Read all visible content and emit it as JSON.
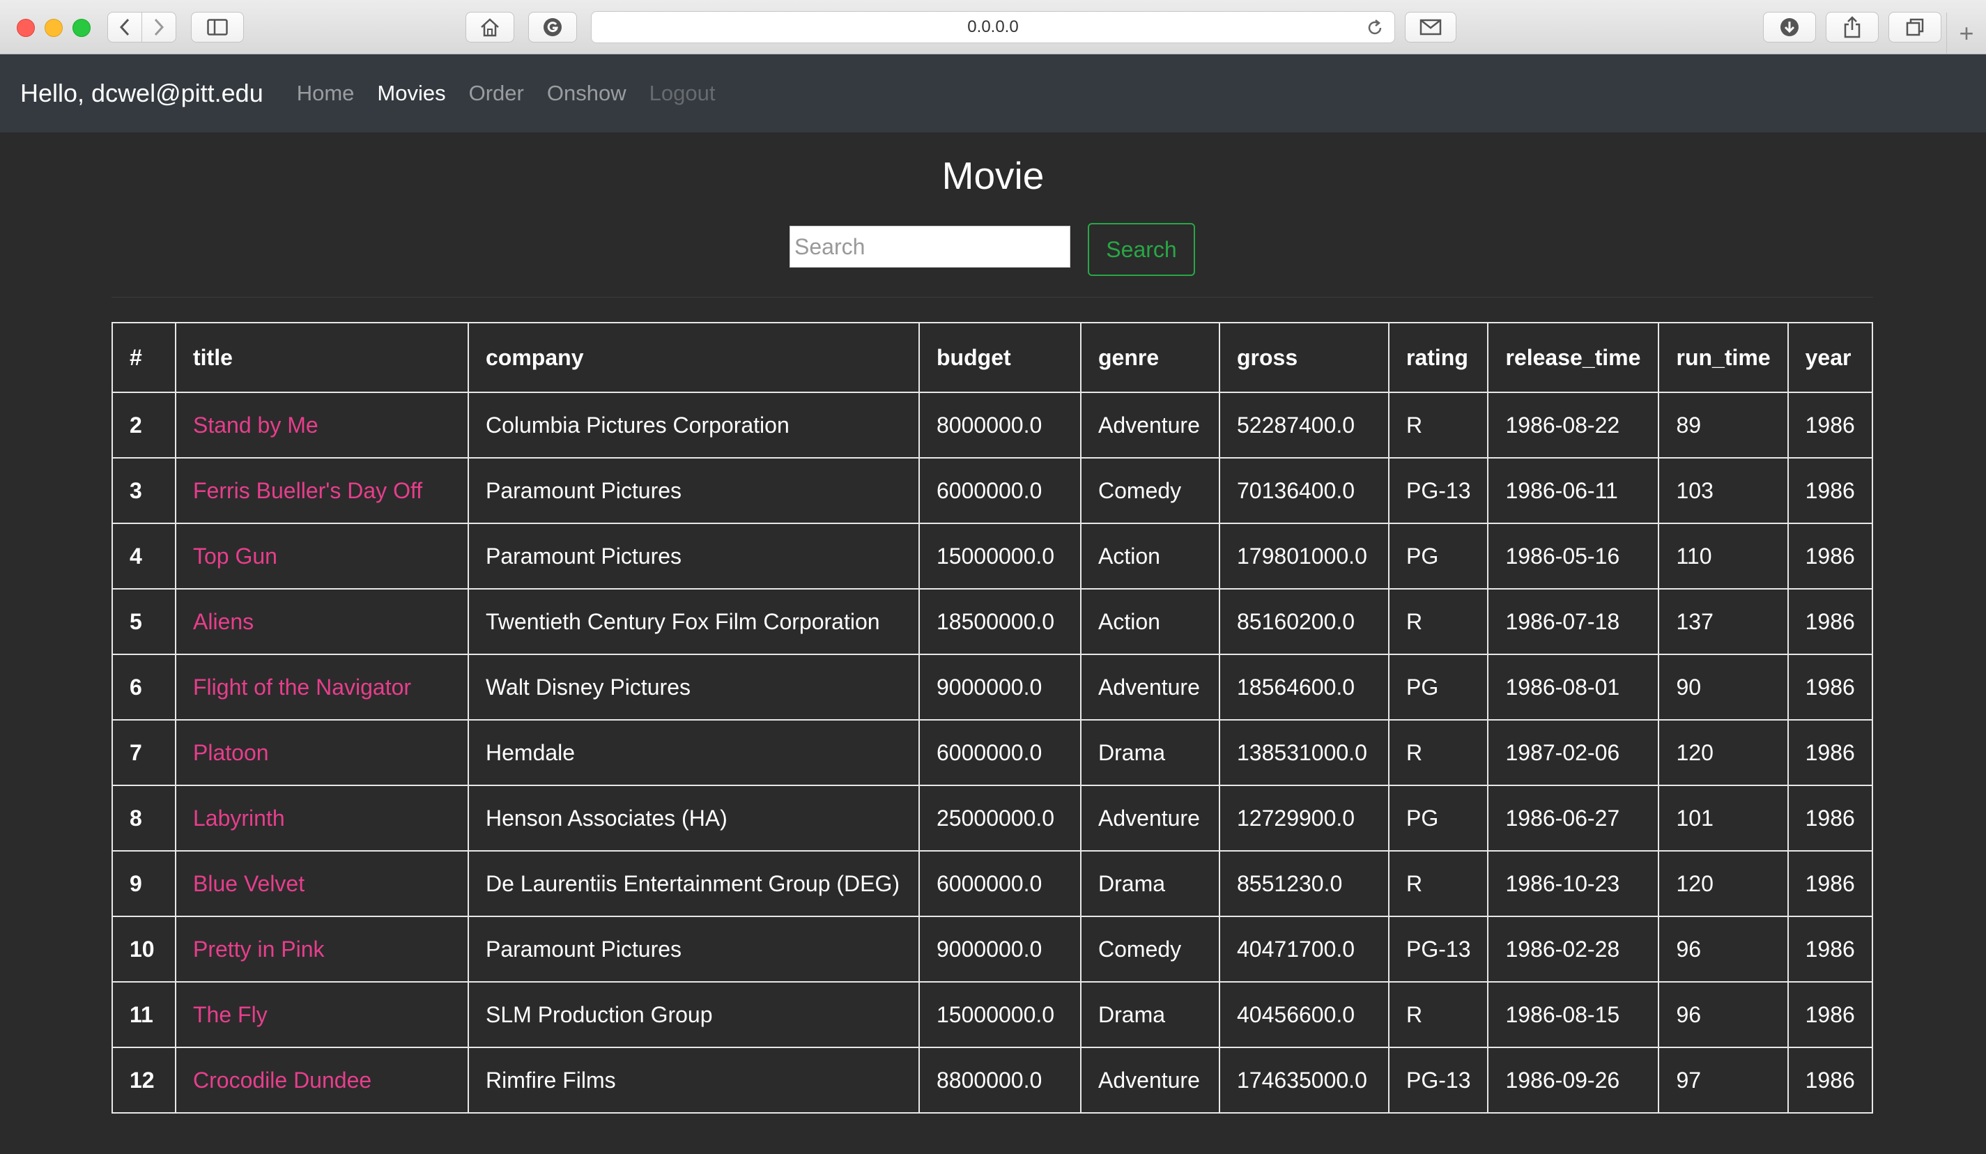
{
  "browser": {
    "url": "0.0.0.0"
  },
  "navbar": {
    "greeting": "Hello, dcwel@pitt.edu",
    "links": [
      {
        "label": "Home",
        "state": "normal"
      },
      {
        "label": "Movies",
        "state": "active"
      },
      {
        "label": "Order",
        "state": "normal"
      },
      {
        "label": "Onshow",
        "state": "normal"
      },
      {
        "label": "Logout",
        "state": "disabled"
      }
    ]
  },
  "page": {
    "title": "Movie",
    "search_placeholder": "Search",
    "search_button": "Search"
  },
  "table": {
    "headers": [
      "#",
      "title",
      "company",
      "budget",
      "genre",
      "gross",
      "rating",
      "release_time",
      "run_time",
      "year"
    ],
    "rows": [
      [
        "2",
        "Stand by Me",
        "Columbia Pictures Corporation",
        "8000000.0",
        "Adventure",
        "52287400.0",
        "R",
        "1986-08-22",
        "89",
        "1986"
      ],
      [
        "3",
        "Ferris Bueller's Day Off",
        "Paramount Pictures",
        "6000000.0",
        "Comedy",
        "70136400.0",
        "PG-13",
        "1986-06-11",
        "103",
        "1986"
      ],
      [
        "4",
        "Top Gun",
        "Paramount Pictures",
        "15000000.0",
        "Action",
        "179801000.0",
        "PG",
        "1986-05-16",
        "110",
        "1986"
      ],
      [
        "5",
        "Aliens",
        "Twentieth Century Fox Film Corporation",
        "18500000.0",
        "Action",
        "85160200.0",
        "R",
        "1986-07-18",
        "137",
        "1986"
      ],
      [
        "6",
        "Flight of the Navigator",
        "Walt Disney Pictures",
        "9000000.0",
        "Adventure",
        "18564600.0",
        "PG",
        "1986-08-01",
        "90",
        "1986"
      ],
      [
        "7",
        "Platoon",
        "Hemdale",
        "6000000.0",
        "Drama",
        "138531000.0",
        "R",
        "1987-02-06",
        "120",
        "1986"
      ],
      [
        "8",
        "Labyrinth",
        "Henson Associates (HA)",
        "25000000.0",
        "Adventure",
        "12729900.0",
        "PG",
        "1986-06-27",
        "101",
        "1986"
      ],
      [
        "9",
        "Blue Velvet",
        "De Laurentiis Entertainment Group (DEG)",
        "6000000.0",
        "Drama",
        "8551230.0",
        "R",
        "1986-10-23",
        "120",
        "1986"
      ],
      [
        "10",
        "Pretty in Pink",
        "Paramount Pictures",
        "9000000.0",
        "Comedy",
        "40471700.0",
        "PG-13",
        "1986-02-28",
        "96",
        "1986"
      ],
      [
        "11",
        "The Fly",
        "SLM Production Group",
        "15000000.0",
        "Drama",
        "40456600.0",
        "R",
        "1986-08-15",
        "96",
        "1986"
      ],
      [
        "12",
        "Crocodile Dundee",
        "Rimfire Films",
        "8800000.0",
        "Adventure",
        "174635000.0",
        "PG-13",
        "1986-09-26",
        "97",
        "1986"
      ]
    ]
  },
  "colors": {
    "navbar_bg": "#343a40",
    "page_bg": "#2b2b2b",
    "link_pink": "#e83e8c",
    "search_green": "#28a745"
  }
}
